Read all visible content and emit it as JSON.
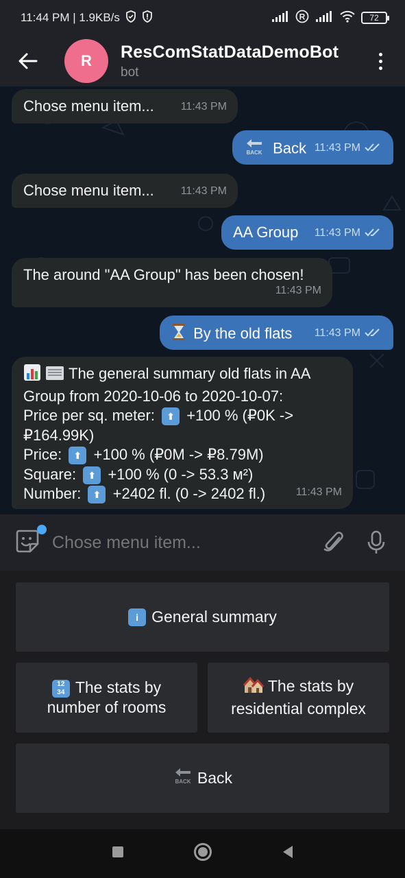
{
  "status_bar": {
    "time_speed": "11:44 PM | 1.9KB/s",
    "battery": "72"
  },
  "header": {
    "avatar_letter": "R",
    "title": "ResComStatDataDemoBot",
    "subtitle": "bot"
  },
  "messages": [
    {
      "dir": "in",
      "text": "Chose menu item...",
      "time": "11:43 PM"
    },
    {
      "dir": "out",
      "text": "Back",
      "icon": "back-arrow-icon",
      "time": "11:43 PM"
    },
    {
      "dir": "in",
      "text": "Chose menu item...",
      "time": "11:43 PM"
    },
    {
      "dir": "out",
      "text": "AA Group",
      "time": "11:43 PM"
    },
    {
      "dir": "in",
      "text": "The around \"AA Group\" has been chosen!",
      "time": "11:43 PM"
    },
    {
      "dir": "out",
      "text": "By the old flats",
      "icon": "hourglass-icon",
      "time": "11:43 PM"
    },
    {
      "dir": "in",
      "lines": [
        "The general summary old flats in AA",
        "Group from 2020-10-06 to 2020-10-07:",
        "Price per sq. meter:",
        "+100 % (₽0K ->",
        "₽164.99K)",
        "Price:",
        "+100 % (₽0M -> ₽8.79M)",
        "Square:",
        "+100 % (0 -> 53.3 м²)",
        "Number:",
        "+2402 fl. (0 -> 2402 fl.)"
      ],
      "time": "11:43 PM"
    }
  ],
  "input": {
    "placeholder": "Chose menu item..."
  },
  "keyboard": {
    "general_summary": "General summary",
    "stats_rooms_line1": "The stats by",
    "stats_rooms_line2": "number of rooms",
    "stats_complex_line1": "The stats by",
    "stats_complex_line2": "residential complex",
    "back": "Back"
  },
  "icons": {
    "general_summary": "info-icon",
    "stats_rooms": "numbers-icon",
    "stats_complex": "houses-icon",
    "back": "back-arrow-icon"
  },
  "colors": {
    "outgoing_bubble": "#3a73b8",
    "incoming_bubble": "#252829",
    "avatar": "#ef6e8d"
  }
}
